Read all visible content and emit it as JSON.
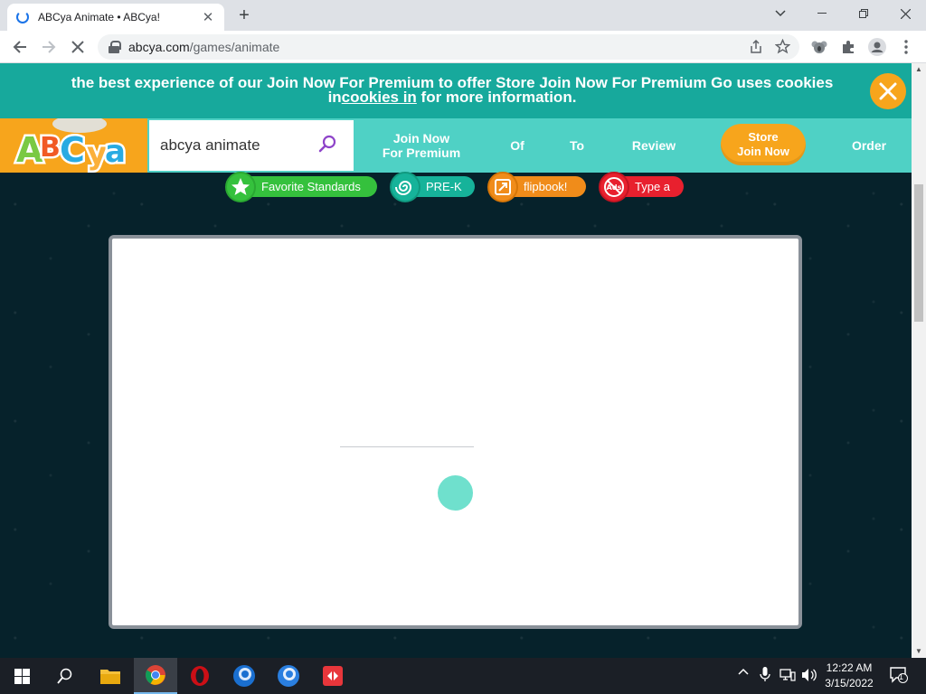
{
  "browser": {
    "tab_title": "ABCya Animate • ABCya!",
    "url_host": "abcya.com",
    "url_path": "/games/animate"
  },
  "cookie_banner": {
    "text_line1": "the best experience of our Join Now For Premium to offer Store Join Now For Premium Go uses cookies",
    "text_prefix": "in",
    "link_text": "cookies in",
    "text_suffix": " for more information."
  },
  "site": {
    "logo_text": "ABCya",
    "search_value": "abcya animate",
    "nav": [
      {
        "label_line1": "Join Now",
        "label_line2": "For Premium"
      },
      {
        "label": "Of"
      },
      {
        "label": "To"
      },
      {
        "label": "Review"
      },
      {
        "label_line1": "Store",
        "label_line2": "Join Now"
      },
      {
        "label": "Order"
      }
    ]
  },
  "chips": [
    {
      "label": "Favorite Standards",
      "color": "#35c13d",
      "icon": "star-icon"
    },
    {
      "label": "PRE-K",
      "color": "#16b39a",
      "icon": "spiral-icon"
    },
    {
      "label": "flipbook!",
      "color": "#f08c1a",
      "icon": "expand-icon"
    },
    {
      "label": "Type a",
      "color": "#e8202e",
      "icon": "ads-icon"
    }
  ],
  "taskbar": {
    "time": "12:22 AM",
    "date": "3/15/2022",
    "notification_count": "1"
  }
}
